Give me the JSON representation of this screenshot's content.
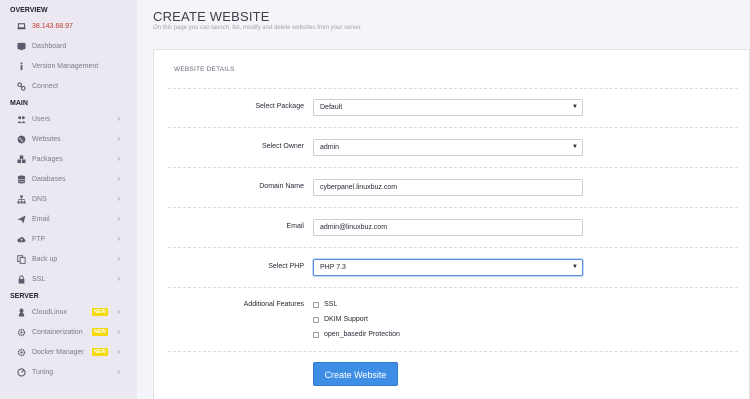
{
  "sidebar": {
    "overview_title": "OVERVIEW",
    "overview": [
      {
        "label": "38.143.68.97",
        "icon": "laptop-icon"
      },
      {
        "label": "Dashboard",
        "icon": "dashboard-icon"
      },
      {
        "label": "Version Management",
        "icon": "info-icon"
      },
      {
        "label": "Connect",
        "icon": "link-icon"
      }
    ],
    "main_title": "MAIN",
    "main": [
      {
        "label": "Users",
        "icon": "users-icon"
      },
      {
        "label": "Websites",
        "icon": "globe-icon"
      },
      {
        "label": "Packages",
        "icon": "cubes-icon"
      },
      {
        "label": "Databases",
        "icon": "database-icon"
      },
      {
        "label": "DNS",
        "icon": "sitemap-icon"
      },
      {
        "label": "Email",
        "icon": "paper-plane-icon"
      },
      {
        "label": "FTP",
        "icon": "cloud-upload-icon"
      },
      {
        "label": "Back up",
        "icon": "copy-icon"
      },
      {
        "label": "SSL",
        "icon": "lock-icon"
      }
    ],
    "server_title": "SERVER",
    "server": [
      {
        "label": "CloudLinux",
        "icon": "linux-icon",
        "badge": "NEW"
      },
      {
        "label": "Containerization",
        "icon": "cog-icon",
        "badge": "NEW"
      },
      {
        "label": "Docker Manager",
        "icon": "docker-icon",
        "badge": "NEW"
      },
      {
        "label": "Tuning",
        "icon": "tuning-icon"
      }
    ]
  },
  "header": {
    "title": "CREATE WEBSITE",
    "subtitle": "On this page you can launch, list, modify and delete websites from your server."
  },
  "form": {
    "section_title": "WEBSITE DETAILS",
    "package_label": "Select Package",
    "package_value": "Default",
    "owner_label": "Select Owner",
    "owner_value": "admin",
    "domain_label": "Domain Name",
    "domain_value": "cyberpanel.linuxbuz.com",
    "email_label": "Email",
    "email_value": "admin@linuxbuz.com",
    "php_label": "Select PHP",
    "php_value": "PHP 7.3",
    "features_label": "Additional Features",
    "features": [
      "SSL",
      "DKIM Support",
      "open_basedir Protection"
    ],
    "submit_label": "Create Website"
  },
  "colors": {
    "accent": "#3e8ee6",
    "ip_red": "#c0392b",
    "badge_yellow": "#f5d90a"
  }
}
